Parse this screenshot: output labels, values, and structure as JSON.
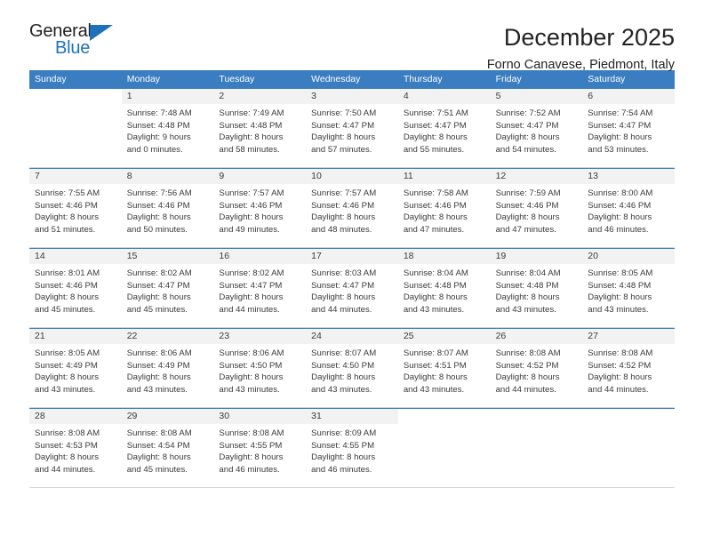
{
  "brand": {
    "name_top": "General",
    "name_bottom": "Blue",
    "accent": "#1b72bb"
  },
  "header": {
    "month_title": "December 2025",
    "location": "Forno Canavese, Piedmont, Italy"
  },
  "calendar": {
    "header_bg": "#3a7dc0",
    "weekdays": [
      "Sunday",
      "Monday",
      "Tuesday",
      "Wednesday",
      "Thursday",
      "Friday",
      "Saturday"
    ],
    "weeks": [
      [
        {
          "day": ""
        },
        {
          "day": "1",
          "sunrise": "Sunrise: 7:48 AM",
          "sunset": "Sunset: 4:48 PM",
          "daylight1": "Daylight: 9 hours",
          "daylight2": "and 0 minutes."
        },
        {
          "day": "2",
          "sunrise": "Sunrise: 7:49 AM",
          "sunset": "Sunset: 4:48 PM",
          "daylight1": "Daylight: 8 hours",
          "daylight2": "and 58 minutes."
        },
        {
          "day": "3",
          "sunrise": "Sunrise: 7:50 AM",
          "sunset": "Sunset: 4:47 PM",
          "daylight1": "Daylight: 8 hours",
          "daylight2": "and 57 minutes."
        },
        {
          "day": "4",
          "sunrise": "Sunrise: 7:51 AM",
          "sunset": "Sunset: 4:47 PM",
          "daylight1": "Daylight: 8 hours",
          "daylight2": "and 55 minutes."
        },
        {
          "day": "5",
          "sunrise": "Sunrise: 7:52 AM",
          "sunset": "Sunset: 4:47 PM",
          "daylight1": "Daylight: 8 hours",
          "daylight2": "and 54 minutes."
        },
        {
          "day": "6",
          "sunrise": "Sunrise: 7:54 AM",
          "sunset": "Sunset: 4:47 PM",
          "daylight1": "Daylight: 8 hours",
          "daylight2": "and 53 minutes."
        }
      ],
      [
        {
          "day": "7",
          "sunrise": "Sunrise: 7:55 AM",
          "sunset": "Sunset: 4:46 PM",
          "daylight1": "Daylight: 8 hours",
          "daylight2": "and 51 minutes."
        },
        {
          "day": "8",
          "sunrise": "Sunrise: 7:56 AM",
          "sunset": "Sunset: 4:46 PM",
          "daylight1": "Daylight: 8 hours",
          "daylight2": "and 50 minutes."
        },
        {
          "day": "9",
          "sunrise": "Sunrise: 7:57 AM",
          "sunset": "Sunset: 4:46 PM",
          "daylight1": "Daylight: 8 hours",
          "daylight2": "and 49 minutes."
        },
        {
          "day": "10",
          "sunrise": "Sunrise: 7:57 AM",
          "sunset": "Sunset: 4:46 PM",
          "daylight1": "Daylight: 8 hours",
          "daylight2": "and 48 minutes."
        },
        {
          "day": "11",
          "sunrise": "Sunrise: 7:58 AM",
          "sunset": "Sunset: 4:46 PM",
          "daylight1": "Daylight: 8 hours",
          "daylight2": "and 47 minutes."
        },
        {
          "day": "12",
          "sunrise": "Sunrise: 7:59 AM",
          "sunset": "Sunset: 4:46 PM",
          "daylight1": "Daylight: 8 hours",
          "daylight2": "and 47 minutes."
        },
        {
          "day": "13",
          "sunrise": "Sunrise: 8:00 AM",
          "sunset": "Sunset: 4:46 PM",
          "daylight1": "Daylight: 8 hours",
          "daylight2": "and 46 minutes."
        }
      ],
      [
        {
          "day": "14",
          "sunrise": "Sunrise: 8:01 AM",
          "sunset": "Sunset: 4:46 PM",
          "daylight1": "Daylight: 8 hours",
          "daylight2": "and 45 minutes."
        },
        {
          "day": "15",
          "sunrise": "Sunrise: 8:02 AM",
          "sunset": "Sunset: 4:47 PM",
          "daylight1": "Daylight: 8 hours",
          "daylight2": "and 45 minutes."
        },
        {
          "day": "16",
          "sunrise": "Sunrise: 8:02 AM",
          "sunset": "Sunset: 4:47 PM",
          "daylight1": "Daylight: 8 hours",
          "daylight2": "and 44 minutes."
        },
        {
          "day": "17",
          "sunrise": "Sunrise: 8:03 AM",
          "sunset": "Sunset: 4:47 PM",
          "daylight1": "Daylight: 8 hours",
          "daylight2": "and 44 minutes."
        },
        {
          "day": "18",
          "sunrise": "Sunrise: 8:04 AM",
          "sunset": "Sunset: 4:48 PM",
          "daylight1": "Daylight: 8 hours",
          "daylight2": "and 43 minutes."
        },
        {
          "day": "19",
          "sunrise": "Sunrise: 8:04 AM",
          "sunset": "Sunset: 4:48 PM",
          "daylight1": "Daylight: 8 hours",
          "daylight2": "and 43 minutes."
        },
        {
          "day": "20",
          "sunrise": "Sunrise: 8:05 AM",
          "sunset": "Sunset: 4:48 PM",
          "daylight1": "Daylight: 8 hours",
          "daylight2": "and 43 minutes."
        }
      ],
      [
        {
          "day": "21",
          "sunrise": "Sunrise: 8:05 AM",
          "sunset": "Sunset: 4:49 PM",
          "daylight1": "Daylight: 8 hours",
          "daylight2": "and 43 minutes."
        },
        {
          "day": "22",
          "sunrise": "Sunrise: 8:06 AM",
          "sunset": "Sunset: 4:49 PM",
          "daylight1": "Daylight: 8 hours",
          "daylight2": "and 43 minutes."
        },
        {
          "day": "23",
          "sunrise": "Sunrise: 8:06 AM",
          "sunset": "Sunset: 4:50 PM",
          "daylight1": "Daylight: 8 hours",
          "daylight2": "and 43 minutes."
        },
        {
          "day": "24",
          "sunrise": "Sunrise: 8:07 AM",
          "sunset": "Sunset: 4:50 PM",
          "daylight1": "Daylight: 8 hours",
          "daylight2": "and 43 minutes."
        },
        {
          "day": "25",
          "sunrise": "Sunrise: 8:07 AM",
          "sunset": "Sunset: 4:51 PM",
          "daylight1": "Daylight: 8 hours",
          "daylight2": "and 43 minutes."
        },
        {
          "day": "26",
          "sunrise": "Sunrise: 8:08 AM",
          "sunset": "Sunset: 4:52 PM",
          "daylight1": "Daylight: 8 hours",
          "daylight2": "and 44 minutes."
        },
        {
          "day": "27",
          "sunrise": "Sunrise: 8:08 AM",
          "sunset": "Sunset: 4:52 PM",
          "daylight1": "Daylight: 8 hours",
          "daylight2": "and 44 minutes."
        }
      ],
      [
        {
          "day": "28",
          "sunrise": "Sunrise: 8:08 AM",
          "sunset": "Sunset: 4:53 PM",
          "daylight1": "Daylight: 8 hours",
          "daylight2": "and 44 minutes."
        },
        {
          "day": "29",
          "sunrise": "Sunrise: 8:08 AM",
          "sunset": "Sunset: 4:54 PM",
          "daylight1": "Daylight: 8 hours",
          "daylight2": "and 45 minutes."
        },
        {
          "day": "30",
          "sunrise": "Sunrise: 8:08 AM",
          "sunset": "Sunset: 4:55 PM",
          "daylight1": "Daylight: 8 hours",
          "daylight2": "and 46 minutes."
        },
        {
          "day": "31",
          "sunrise": "Sunrise: 8:09 AM",
          "sunset": "Sunset: 4:55 PM",
          "daylight1": "Daylight: 8 hours",
          "daylight2": "and 46 minutes."
        },
        {
          "day": ""
        },
        {
          "day": ""
        },
        {
          "day": ""
        }
      ]
    ]
  }
}
